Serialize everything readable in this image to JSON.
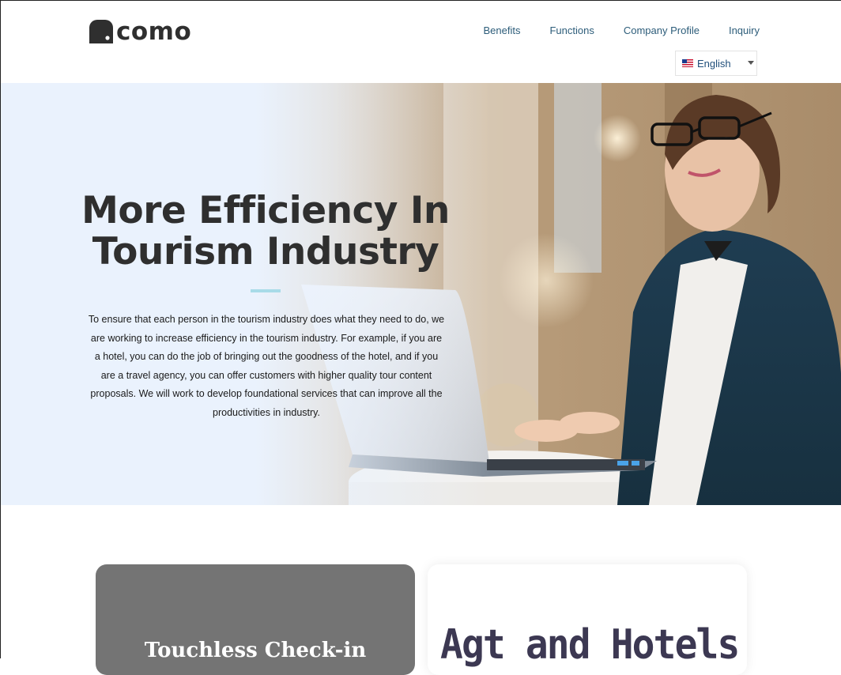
{
  "header": {
    "logo_text": "como",
    "nav": [
      "Benefits",
      "Functions",
      "Company Profile",
      "Inquiry"
    ],
    "language": {
      "selected": "English",
      "flag_icon": "us-flag-icon"
    }
  },
  "hero": {
    "title_line1": "More Efficiency In",
    "title_line2": "Tourism Industry",
    "body": "To ensure that each person in the tourism industry does what they need to do, we are working to increase efficiency in the tourism industry. For example, if you are a hotel, you can do the job of bringing out the goodness of the hotel, and if you are a travel agency, you can offer customers with higher quality tour content proposals. We will work to develop foundational services that can improve all the productivities in industry."
  },
  "cards": [
    {
      "title": "Touchless Check-in",
      "background": "#747474"
    },
    {
      "title": "Agt and Hotels",
      "background": "#ffffff"
    }
  ],
  "colors": {
    "nav_link": "#2d5d7a",
    "heading": "#2f2f2f",
    "divider": "#a8dbe8",
    "hero_bg": "#eaf2fd"
  }
}
